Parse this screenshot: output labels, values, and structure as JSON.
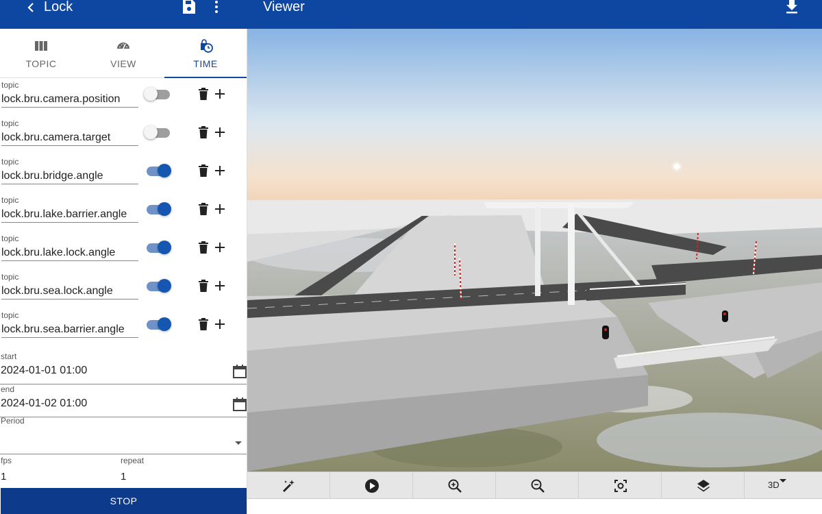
{
  "appbar": {
    "title": "Lock",
    "viewer_title": "Viewer",
    "back_icon": "chevron-left-icon",
    "save_icon": "floppy-disk-icon",
    "more_icon": "more-vertical-icon",
    "download_icon": "download-icon",
    "color": "#0d47a1"
  },
  "tabs": [
    {
      "label": "TOPIC",
      "icon": "columns-icon",
      "active": false
    },
    {
      "label": "VIEW",
      "icon": "gauge-icon",
      "active": false
    },
    {
      "label": "TIME",
      "icon": "clock-bag-icon",
      "active": true
    }
  ],
  "topics": [
    {
      "label": "topic",
      "value": "lock.bru.camera.position",
      "enabled": false
    },
    {
      "label": "topic",
      "value": "lock.bru.camera.target",
      "enabled": false
    },
    {
      "label": "topic",
      "value": "lock.bru.bridge.angle",
      "enabled": true
    },
    {
      "label": "topic",
      "value": "lock.bru.lake.barrier.angle",
      "enabled": true
    },
    {
      "label": "topic",
      "value": "lock.bru.lake.lock.angle",
      "enabled": true
    },
    {
      "label": "topic",
      "value": "lock.bru.sea.lock.angle",
      "enabled": true
    },
    {
      "label": "topic",
      "value": "lock.bru.sea.barrier.angle",
      "enabled": true
    }
  ],
  "time": {
    "start_label": "start",
    "start_value": "2024-01-01 01:00",
    "end_label": "end",
    "end_value": "2024-01-02 01:00",
    "period_label": "Period",
    "period_value": "",
    "fps_label": "fps",
    "fps_value": "1",
    "repeat_label": "repeat",
    "repeat_value": "1",
    "stop_label": "STOP"
  },
  "toolbar": {
    "buttons": [
      "magic-wand-icon",
      "play-icon",
      "zoom-in-icon",
      "zoom-out-icon",
      "focus-icon",
      "layers-icon"
    ],
    "mode_label": "3D"
  }
}
